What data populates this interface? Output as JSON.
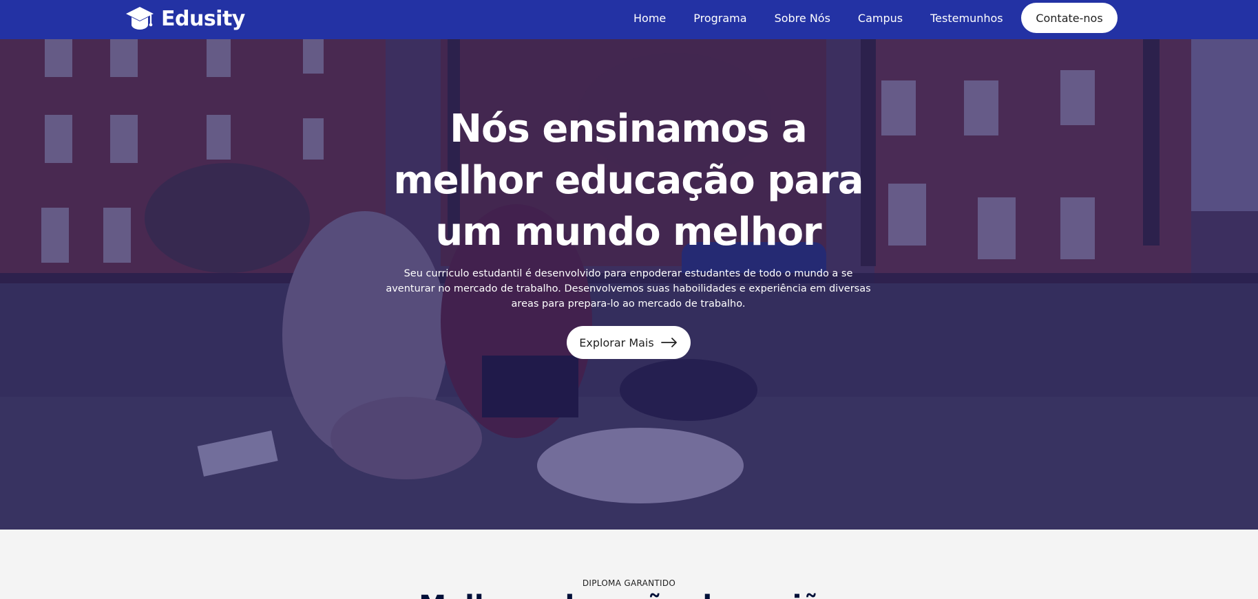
{
  "brand": {
    "name": "Edusity",
    "icon": "graduation-cap-icon"
  },
  "nav": {
    "links": [
      "Home",
      "Programa",
      "Sobre Nós",
      "Campus",
      "Testemunhos"
    ],
    "contact_label": "Contate-nos"
  },
  "hero": {
    "title": "Nós ensinamos a melhor educação para um mundo melhor",
    "subtitle": "Seu curriculo estudantil é desenvolvido para enpoderar estudantes de todo o mundo a se aventurar no mercado de trabalho. Desenvolvemos suas haboilidades e experiência em diversas areas para prepara-lo ao mercado de trabalho.",
    "button_label": "Explorar Mais",
    "button_icon": "arrow-right-icon"
  },
  "programs": {
    "eyebrow": "DIPLOMA GARANTIDO",
    "title": "Melhor educação da região"
  },
  "colors": {
    "nav_background": "#2332a4",
    "hero_overlay": "#201a64",
    "button_background": "#ffffff",
    "section_background": "#f4f4f4",
    "title_color": "#000f38"
  }
}
